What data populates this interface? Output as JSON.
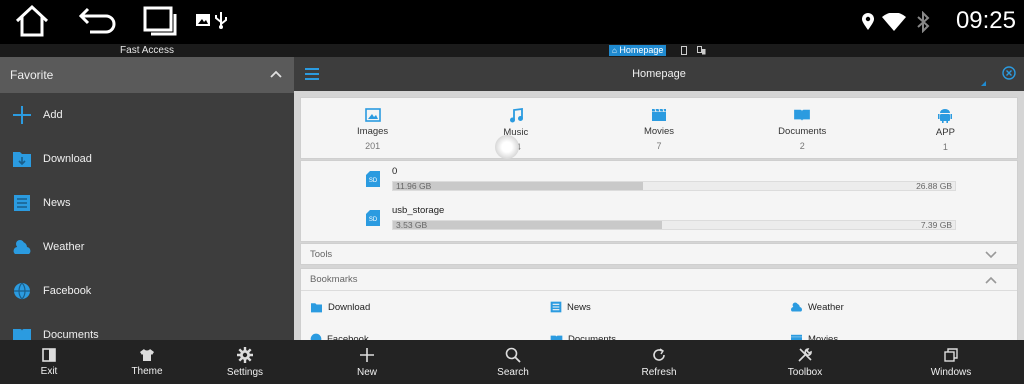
{
  "status_bar": {
    "time": "09:25",
    "icons": [
      "home-icon",
      "back-icon",
      "recent-apps-icon",
      "image-icon",
      "usb-icon",
      "location-icon",
      "wifi-icon",
      "bluetooth-icon"
    ]
  },
  "left_panel": {
    "fast_access": "Fast Access",
    "favorite": "Favorite",
    "items": [
      {
        "label": "Add",
        "icon": "plus-icon"
      },
      {
        "label": "Download",
        "icon": "download-folder-icon"
      },
      {
        "label": "News",
        "icon": "news-icon"
      },
      {
        "label": "Weather",
        "icon": "weather-icon"
      },
      {
        "label": "Facebook",
        "icon": "globe-icon"
      },
      {
        "label": "Documents",
        "icon": "book-icon"
      }
    ],
    "bottom": [
      {
        "label": "Exit",
        "icon": "exit-icon"
      },
      {
        "label": "Theme",
        "icon": "shirt-icon"
      },
      {
        "label": "Settings",
        "icon": "gear-icon"
      }
    ]
  },
  "tab_strip": {
    "active_tab": "Homepage"
  },
  "title_bar": {
    "title": "Homepage"
  },
  "categories": [
    {
      "label": "Images",
      "count": "201",
      "icon": "image-icon"
    },
    {
      "label": "Music",
      "count": "24",
      "icon": "music-icon"
    },
    {
      "label": "Movies",
      "count": "7",
      "icon": "film-icon"
    },
    {
      "label": "Documents",
      "count": "2",
      "icon": "book-icon"
    },
    {
      "label": "APP",
      "count": "1",
      "icon": "android-icon"
    }
  ],
  "storage": [
    {
      "name": "0",
      "used": "11.96 GB",
      "total": "26.88 GB",
      "used_fraction": 0.445
    },
    {
      "name": "usb_storage",
      "used": "3.53 GB",
      "total": "7.39 GB",
      "used_fraction": 0.478
    }
  ],
  "sections": {
    "tools": "Tools",
    "bookmarks": "Bookmarks"
  },
  "bookmarks": [
    {
      "label": "Download",
      "icon": "download-folder-icon"
    },
    {
      "label": "News",
      "icon": "news-icon"
    },
    {
      "label": "Weather",
      "icon": "weather-icon"
    },
    {
      "label": "Facebook",
      "icon": "globe-icon"
    },
    {
      "label": "Documents",
      "icon": "book-icon"
    },
    {
      "label": "Movies",
      "icon": "film-icon"
    }
  ],
  "bottom_toolbar": [
    {
      "label": "New",
      "icon": "plus-icon"
    },
    {
      "label": "Search",
      "icon": "search-icon"
    },
    {
      "label": "Refresh",
      "icon": "refresh-icon"
    },
    {
      "label": "Toolbox",
      "icon": "toolbox-icon"
    },
    {
      "label": "Windows",
      "icon": "windows-icon"
    }
  ],
  "colors": {
    "accent": "#1f8ad0",
    "icon_blue": "#2b9be0",
    "panel_dark": "#3d3d3d",
    "toolbar": "#232323"
  }
}
